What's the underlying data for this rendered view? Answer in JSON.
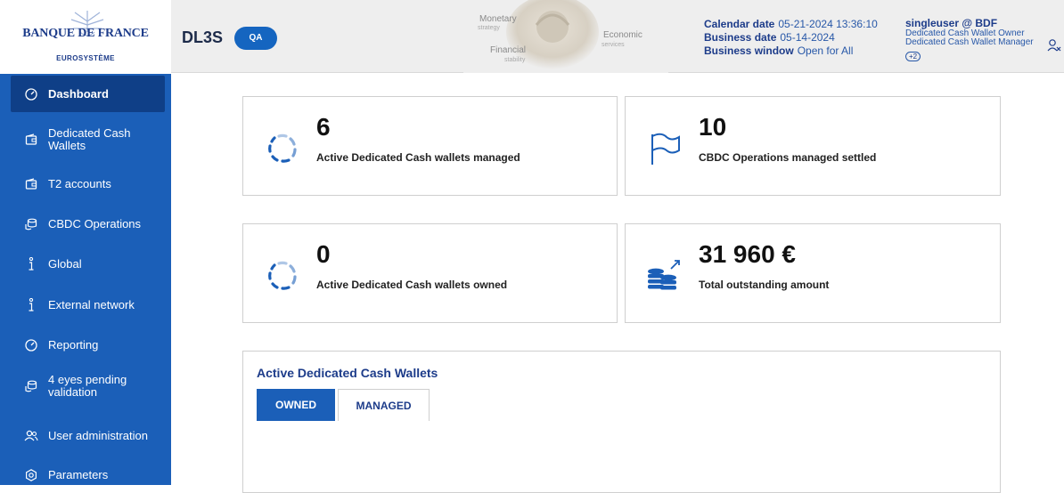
{
  "header": {
    "logo": {
      "title": "BANQUE DE FRANCE",
      "subtitle": "EUROSYSTÈME"
    },
    "app_name": "DL3S",
    "env_badge": "QA",
    "banner": {
      "monetary": "Monetary",
      "strategy": "strategy",
      "financial": "Financial",
      "stability": "stability",
      "economic": "Economic",
      "services": "services"
    },
    "calendar_date_label": "Calendar date",
    "calendar_date_value": "05-21-2024 13:36:10",
    "business_date_label": "Business date",
    "business_date_value": "05-14-2024",
    "business_window_label": "Business window",
    "business_window_value": "Open for All",
    "user": {
      "name": "singleuser @ BDF",
      "roles": [
        "Dedicated Cash Wallet Owner",
        "Dedicated Cash Wallet Manager"
      ],
      "more_roles": "+2"
    }
  },
  "sidebar": {
    "items": [
      {
        "label": "Dashboard",
        "icon": "dashboard-gauge-icon",
        "active": true
      },
      {
        "label": "Dedicated Cash Wallets",
        "icon": "wallet-icon"
      },
      {
        "label": "T2 accounts",
        "icon": "wallet-icon"
      },
      {
        "label": "CBDC Operations",
        "icon": "coins-icon"
      },
      {
        "label": "Global",
        "icon": "info-icon"
      },
      {
        "label": "External network",
        "icon": "info-icon"
      },
      {
        "label": "Reporting",
        "icon": "gauge-icon"
      },
      {
        "label": "4 eyes pending validation",
        "icon": "coins-icon"
      },
      {
        "label": "User administration",
        "icon": "users-icon"
      },
      {
        "label": "Parameters",
        "icon": "gear-icon"
      }
    ]
  },
  "cards": [
    {
      "value": "6",
      "label": "Active Dedicated Cash wallets managed",
      "icon": "spinner-icon"
    },
    {
      "value": "10",
      "label": "CBDC Operations managed settled",
      "icon": "flag-icon"
    },
    {
      "value": "0",
      "label": "Active Dedicated Cash wallets owned",
      "icon": "spinner-icon"
    },
    {
      "value": "31 960 €",
      "label": "Total outstanding amount",
      "icon": "coins-growth-icon"
    }
  ],
  "wallets_panel": {
    "title": "Active Dedicated Cash Wallets",
    "tabs": [
      {
        "label": "OWNED",
        "active": true
      },
      {
        "label": "MANAGED",
        "active": false
      }
    ]
  },
  "colors": {
    "sidebar": "#1b5fb8",
    "sidebar_active": "#0f3f87",
    "brand_text": "#1d3c8a",
    "accent": "#1565c0"
  }
}
